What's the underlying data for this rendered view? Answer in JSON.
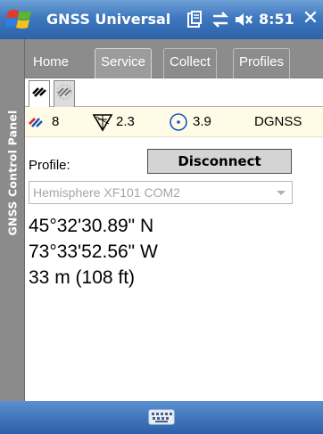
{
  "titlebar": {
    "app_title": "GNSS Universal",
    "time": "8:51",
    "close_label": "✕"
  },
  "side_panel": {
    "label": "GNSS Control Panel"
  },
  "tabs": [
    {
      "label": "Home",
      "active": false
    },
    {
      "label": "Service",
      "active": true
    },
    {
      "label": "Collect",
      "active": false
    },
    {
      "label": "Profiles",
      "active": false
    }
  ],
  "status": {
    "satellites": "8",
    "pdop": "2.3",
    "hdop": "3.9",
    "fix_type": "DGNSS"
  },
  "profile": {
    "label": "Profile:",
    "disconnect_label": "Disconnect",
    "selected": "Hemisphere XF101 COM2"
  },
  "position": {
    "latitude": "45°32'30.89\" N",
    "longitude": "73°33'52.56\" W",
    "altitude": "33 m (108 ft)"
  },
  "colors": {
    "titlebar": "#3f78bf",
    "panel_gray": "#8c8c8c",
    "status_bg": "#fffbe6"
  }
}
